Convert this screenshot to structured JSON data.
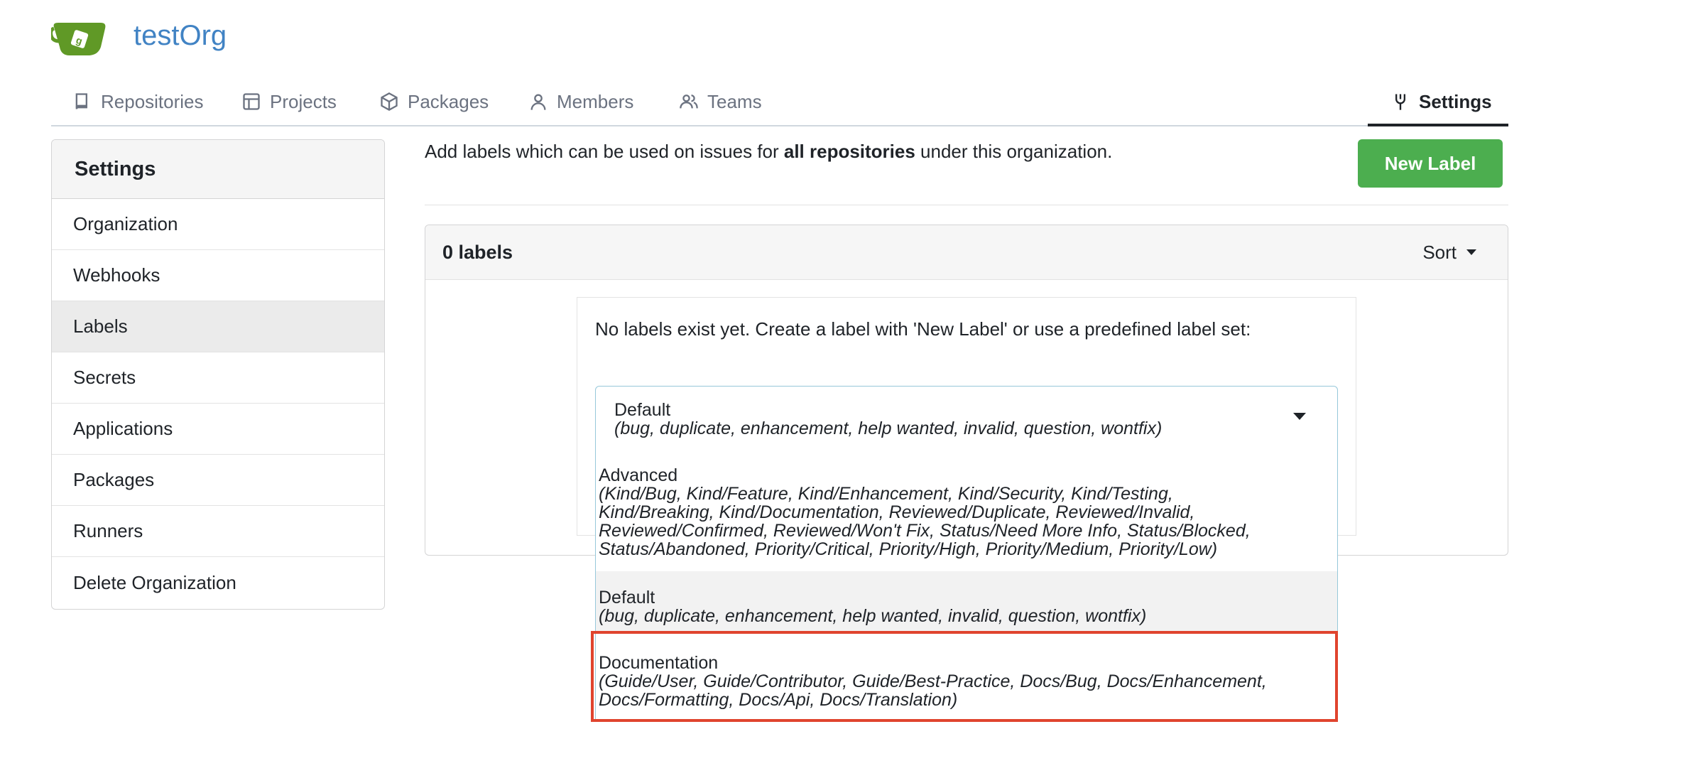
{
  "header": {
    "org_name": "testOrg"
  },
  "nav": {
    "repositories": "Repositories",
    "projects": "Projects",
    "packages": "Packages",
    "members": "Members",
    "teams": "Teams",
    "settings": "Settings"
  },
  "sidebar": {
    "title": "Settings",
    "items": [
      {
        "label": "Organization"
      },
      {
        "label": "Webhooks"
      },
      {
        "label": "Labels",
        "active": true
      },
      {
        "label": "Secrets"
      },
      {
        "label": "Applications"
      },
      {
        "label": "Packages"
      },
      {
        "label": "Runners"
      },
      {
        "label": "Delete Organization"
      }
    ]
  },
  "main": {
    "intro_prefix": "Add labels which can be used on issues for ",
    "intro_bold": "all repositories",
    "intro_suffix": " under this organization.",
    "new_label_button": "New Label",
    "labels_count": "0 labels",
    "sort_label": "Sort",
    "empty_message": "No labels exist yet. Create a label with 'New Label' or use a predefined label set:"
  },
  "label_set_dropdown": {
    "selected": {
      "name": "Default",
      "desc": "(bug, duplicate, enhancement, help wanted, invalid, question, wontfix)"
    },
    "options": [
      {
        "name": "Advanced",
        "desc_lines": [
          "(Kind/Bug, Kind/Feature, Kind/Enhancement, Kind/Security, Kind/Testing,",
          "Kind/Breaking, Kind/Documentation, Reviewed/Duplicate, Reviewed/Invalid,",
          "Reviewed/Confirmed, Reviewed/Won't Fix, Status/Need More Info, Status/Blocked,",
          "Status/Abandoned, Priority/Critical, Priority/High, Priority/Medium, Priority/Low)"
        ]
      },
      {
        "name": "Default",
        "desc_lines": [
          "(bug, duplicate, enhancement, help wanted, invalid, question, wontfix)"
        ],
        "hovered": true
      },
      {
        "name": "Documentation",
        "desc_lines": [
          "(Guide/User, Guide/Contributor, Guide/Best-Practice, Docs/Bug, Docs/Enhancement,",
          "Docs/Formatting, Docs/Api, Docs/Translation)"
        ],
        "highlighted": true
      }
    ]
  },
  "colors": {
    "accent": "#4183c4",
    "primary_button": "#4cae4f",
    "highlight_border": "#e0442e",
    "logo": "#609926"
  },
  "icons": {
    "logo": "gitea-teacup-logo",
    "repositories": "book-icon",
    "projects": "project-board-icon",
    "packages": "package-box-icon",
    "members": "person-icon",
    "teams": "people-icon",
    "settings": "tools-icon"
  }
}
